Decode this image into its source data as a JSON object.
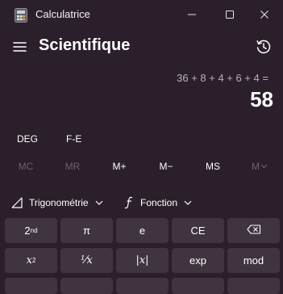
{
  "window": {
    "title": "Calculatrice",
    "app_icon": "calculator-icon",
    "controls": [
      "minimize-icon",
      "maximize-icon",
      "close-icon"
    ]
  },
  "header": {
    "mode_title": "Scientifique",
    "menu_icon": "hamburger-icon",
    "history_icon": "history-icon"
  },
  "display": {
    "expression": "36 + 8 + 4 + 6 + 4 =",
    "result": "58"
  },
  "angle_row": {
    "deg_label": "DEG",
    "fe_label": "F-E"
  },
  "memory_row": {
    "mc": "MC",
    "mr": "MR",
    "mplus": "M+",
    "mminus": "M−",
    "ms": "MS",
    "mlist": "M"
  },
  "function_row": {
    "trig_label": "Trigonométrie",
    "func_label": "Fonction"
  },
  "keypad": {
    "row1": {
      "second": "2",
      "second_sup": "nd",
      "pi": "π",
      "e": "e",
      "ce": "CE",
      "backspace_icon": "backspace-icon"
    },
    "row2": {
      "square": "x",
      "square_sup": "2",
      "reciprocal": "⅟x",
      "abs": "|x|",
      "exp": "exp",
      "mod": "mod"
    }
  },
  "colors": {
    "background": "#2a1f2a",
    "key": "#3f343f",
    "disabled_text": "#6c626c"
  }
}
